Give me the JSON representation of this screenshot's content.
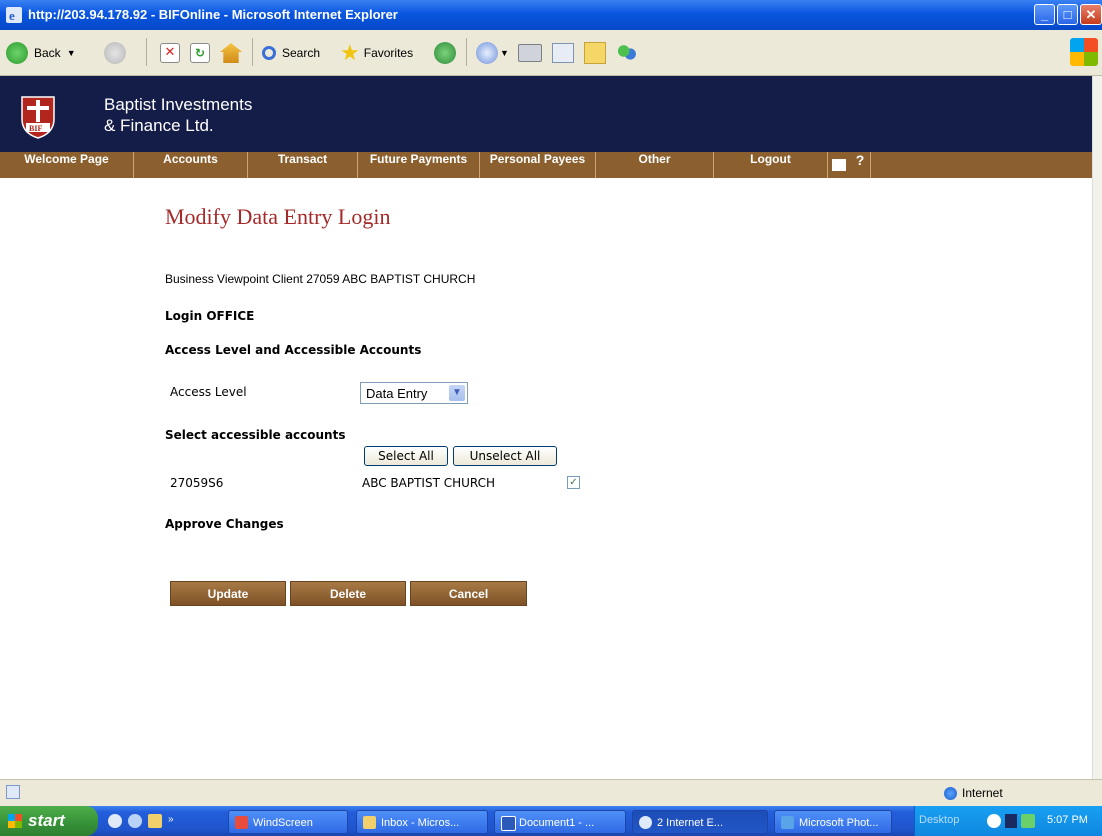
{
  "window": {
    "title": "http://203.94.178.92 - BIFOnline - Microsoft Internet Explorer",
    "min": "_",
    "max": "□",
    "close": "✕"
  },
  "toolbar": {
    "back": "Back",
    "search": "Search",
    "favorites": "Favorites"
  },
  "header": {
    "brand_line1": "Baptist Investments",
    "brand_line2": "& Finance Ltd."
  },
  "nav": {
    "items": [
      "Welcome Page",
      "Accounts",
      "Transact",
      "Future Payments",
      "Personal Payees",
      "Other",
      "Logout"
    ],
    "help": "?"
  },
  "page": {
    "title": "Modify Data Entry Login",
    "client": "Business Viewpoint Client 27059 ABC BAPTIST CHURCH",
    "login": "Login OFFICE",
    "access_heading": "Access Level and Accessible Accounts",
    "access_label": "Access Level",
    "access_value": "Data Entry",
    "select_heading": "Select accessible accounts",
    "select_all": "Select All",
    "unselect_all": "Unselect All",
    "account": {
      "number": "27059S6",
      "name": "ABC BAPTIST CHURCH",
      "checked": true
    },
    "approve_heading": "Approve Changes",
    "buttons": {
      "update": "Update",
      "delete": "Delete",
      "cancel": "Cancel"
    }
  },
  "status": {
    "zone": "Internet"
  },
  "taskbar": {
    "start": "start",
    "tasks": [
      "WindScreen",
      "Inbox - Micros...",
      "Document1 - ...",
      "2 Internet E...",
      "Microsoft Phot..."
    ],
    "desktop": "Desktop",
    "time": "5:07 PM"
  }
}
